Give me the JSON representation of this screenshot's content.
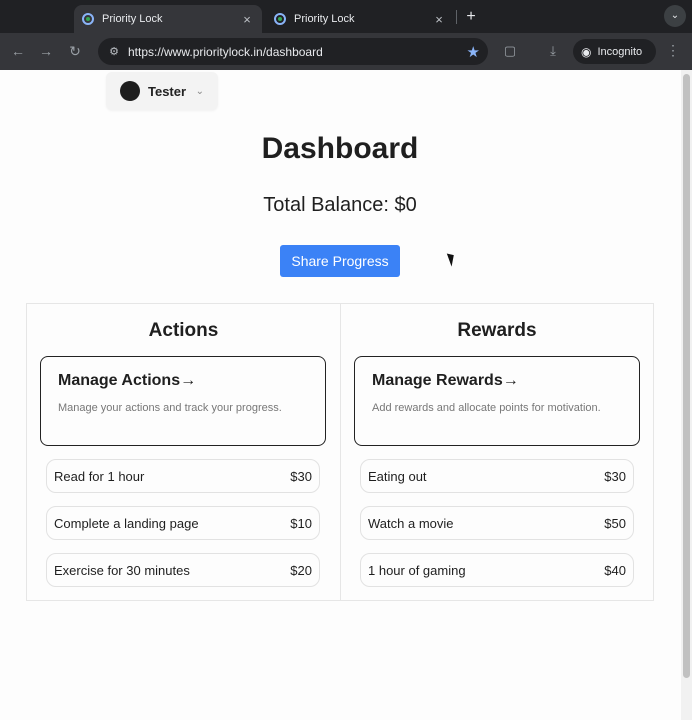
{
  "browser": {
    "tabs": [
      {
        "title": "Priority Lock",
        "close": "×"
      },
      {
        "title": "Priority Lock",
        "close": "×"
      }
    ],
    "new_tab": "+",
    "url": "https://www.prioritylock.in/dashboard",
    "incognito_label": "Incognito"
  },
  "user": {
    "name": "Tester"
  },
  "page": {
    "title": "Dashboard",
    "balance": "Total Balance: $0",
    "share_label": "Share Progress"
  },
  "actions": {
    "heading": "Actions",
    "card_title": "Manage Actions→",
    "card_desc": "Manage your actions and track your progress.",
    "items": [
      {
        "label": "Read for 1 hour",
        "value": "$30"
      },
      {
        "label": "Complete a landing page",
        "value": "$10"
      },
      {
        "label": "Exercise for 30 minutes",
        "value": "$20"
      }
    ]
  },
  "rewards": {
    "heading": "Rewards",
    "card_title": "Manage Rewards→",
    "card_desc": "Add rewards and allocate points for motivation.",
    "items": [
      {
        "label": "Eating out",
        "value": "$30"
      },
      {
        "label": "Watch a movie",
        "value": "$50"
      },
      {
        "label": "1 hour of gaming",
        "value": "$40"
      }
    ]
  },
  "colors": {
    "accent": "#3b82f6",
    "chrome_dark": "#202124",
    "chrome_toolbar": "#35363a"
  }
}
